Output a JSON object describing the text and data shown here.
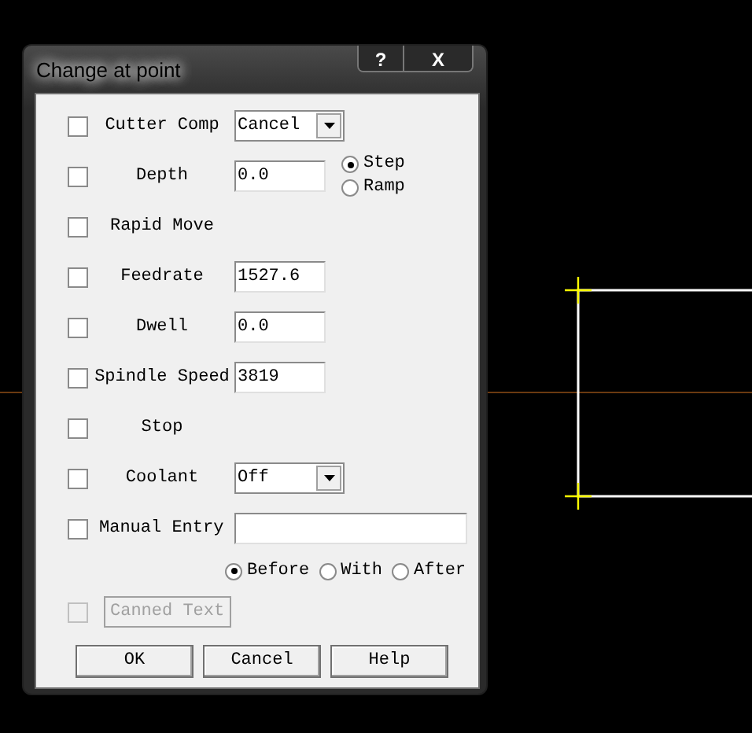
{
  "window": {
    "title": "Change at point",
    "help_button": "?",
    "close_button": "X"
  },
  "options": [
    {
      "kind": "combo",
      "label": "Cutter Comp",
      "checked": false,
      "value": "Cancel"
    },
    {
      "kind": "field",
      "label": "Depth",
      "checked": false,
      "value": "0.0",
      "radios": [
        {
          "label": "Step",
          "selected": true
        },
        {
          "label": "Ramp",
          "selected": false
        }
      ]
    },
    {
      "kind": "plain",
      "label": "Rapid Move",
      "checked": false
    },
    {
      "kind": "field",
      "label": "Feedrate",
      "checked": false,
      "value": "1527.6"
    },
    {
      "kind": "field",
      "label": "Dwell",
      "checked": false,
      "value": "0.0"
    },
    {
      "kind": "field",
      "label": "Spindle Speed",
      "checked": false,
      "value": "3819"
    },
    {
      "kind": "plain",
      "label": "Stop",
      "checked": false
    },
    {
      "kind": "combo",
      "label": "Coolant",
      "checked": false,
      "value": "Off"
    },
    {
      "kind": "wide",
      "label": "Manual Entry",
      "checked": false
    }
  ],
  "placement": [
    {
      "label": "Before",
      "selected": true
    },
    {
      "label": "With",
      "selected": false
    },
    {
      "label": "After",
      "selected": false
    }
  ],
  "canned_text": {
    "label": "Canned Text",
    "checked": false,
    "disabled": true
  },
  "buttons": [
    "OK",
    "Cancel",
    "Help"
  ]
}
